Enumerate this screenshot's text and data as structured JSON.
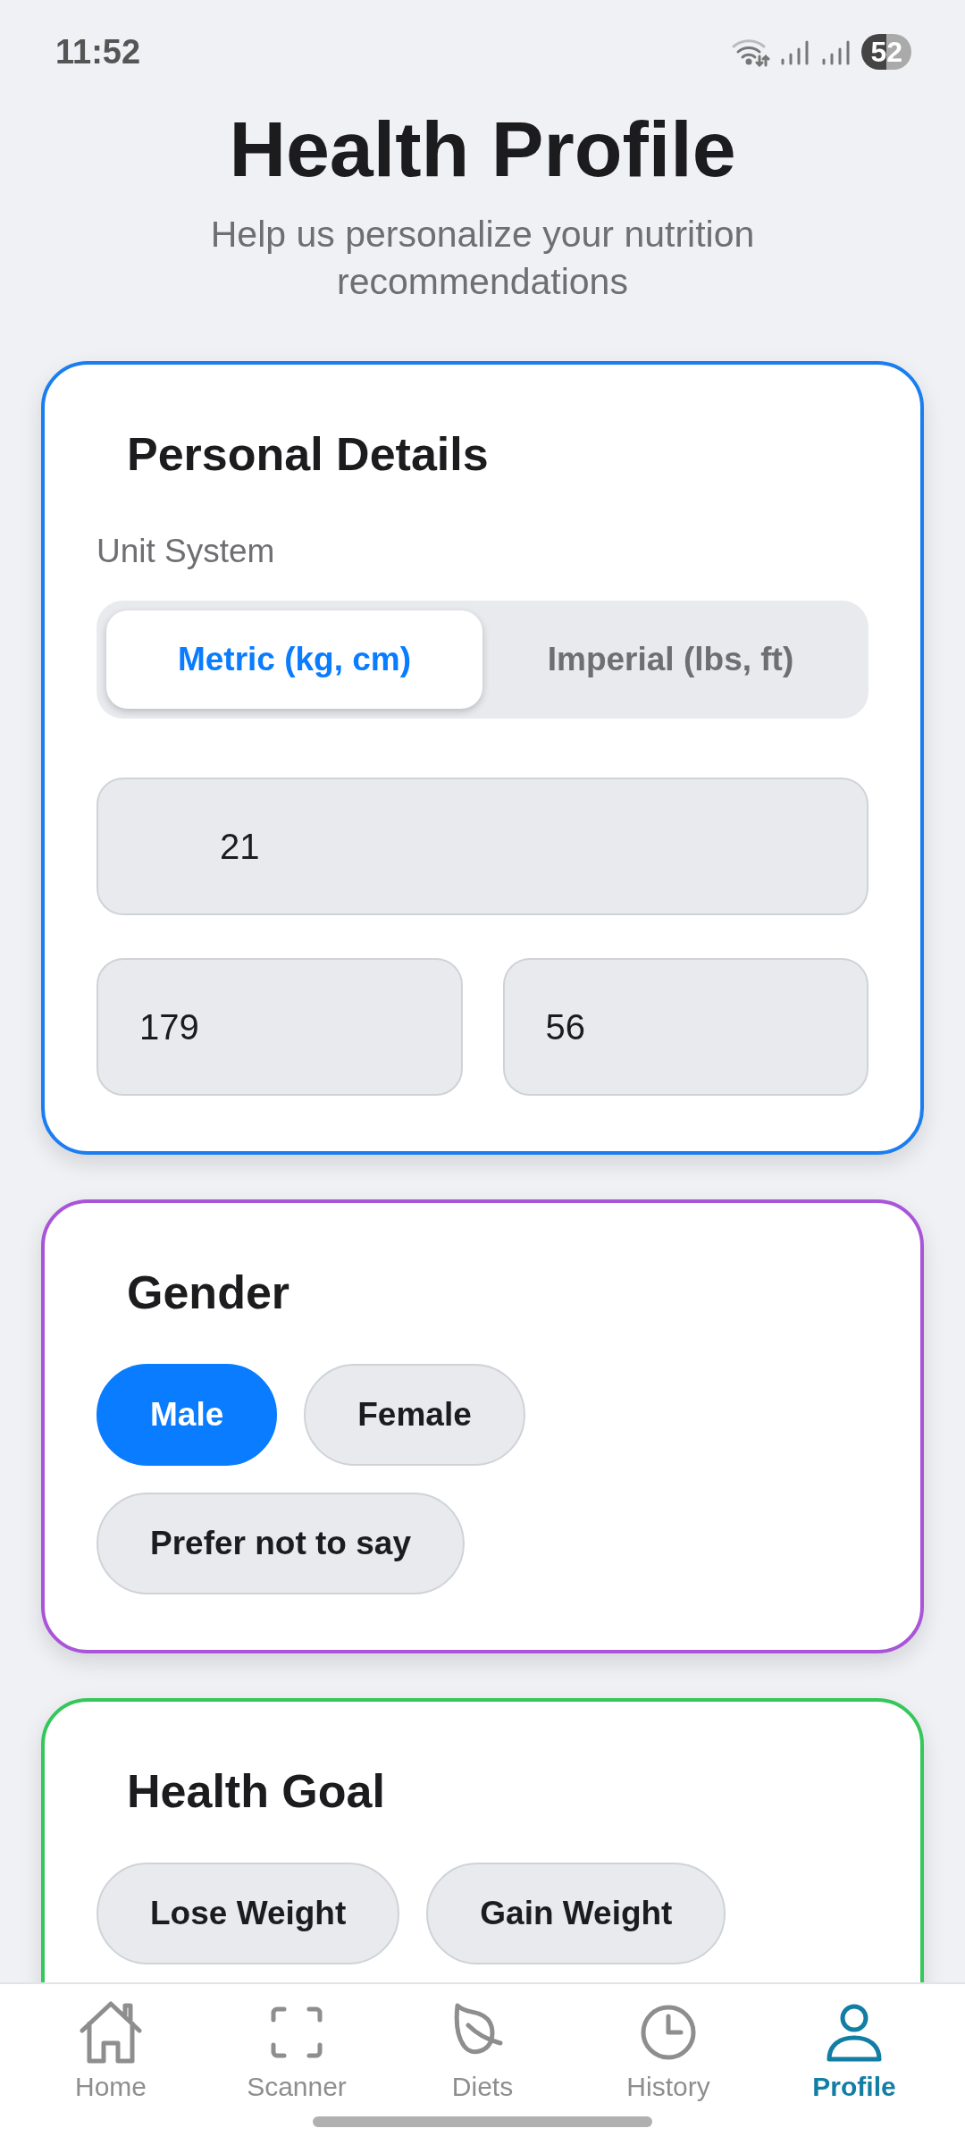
{
  "status_bar": {
    "time": "11:52",
    "battery": "52"
  },
  "header": {
    "title": "Health Profile",
    "subtitle": "Help us personalize your nutrition recommendations"
  },
  "personal_details": {
    "title": "Personal Details",
    "unit_label": "Unit System",
    "units": [
      {
        "label": "Metric (kg, cm)",
        "selected": true
      },
      {
        "label": "Imperial (lbs, ft)",
        "selected": false
      }
    ],
    "age": {
      "value": "21"
    },
    "height": {
      "value": "179"
    },
    "weight": {
      "value": "56"
    }
  },
  "gender": {
    "title": "Gender",
    "options": [
      {
        "label": "Male",
        "selected": true
      },
      {
        "label": "Female",
        "selected": false
      },
      {
        "label": "Prefer not to say",
        "selected": false
      }
    ]
  },
  "health_goal": {
    "title": "Health Goal",
    "options": [
      {
        "label": "Lose Weight",
        "selected": false
      },
      {
        "label": "Gain Weight",
        "selected": false
      }
    ]
  },
  "nav": [
    {
      "label": "Home",
      "selected": false
    },
    {
      "label": "Scanner",
      "selected": false
    },
    {
      "label": "Diets",
      "selected": false
    },
    {
      "label": "History",
      "selected": false
    },
    {
      "label": "Profile",
      "selected": true
    }
  ]
}
